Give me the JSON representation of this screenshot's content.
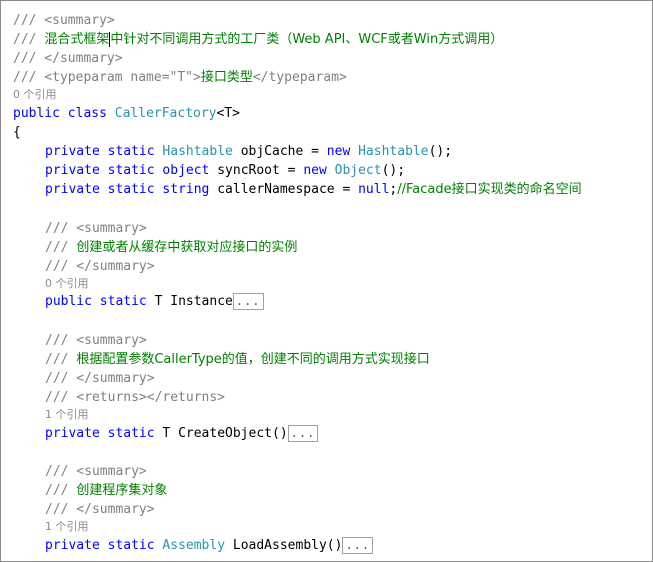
{
  "colors": {
    "keyword": "#0000ff",
    "type": "#2b91af",
    "comment": "#008000",
    "doc_tag": "#808080",
    "ref_hint": "#8a8a8a"
  },
  "class_doc": {
    "summary_open": "/// <summary>",
    "summary_text_a": "混合式框架",
    "summary_text_b": "中针对不同调用方式的工厂类（Web API、WCF或者Win方式调用）",
    "summary_prefix": "/// ",
    "summary_close": "/// </summary>",
    "typeparam_open": "/// <typeparam name=\"T\">",
    "typeparam_text": "接口类型",
    "typeparam_close": "</typeparam>"
  },
  "class_refs": "0 个引用",
  "class_decl": {
    "kw1": "public",
    "kw2": "class",
    "name": "CallerFactory",
    "generic": "<T>"
  },
  "open_brace": "{",
  "fields": [
    {
      "kw1": "private",
      "kw2": "static",
      "type": "Hashtable",
      "name": " objCache = ",
      "kwnew": "new",
      "ctor": "Hashtable",
      "tail": "();"
    },
    {
      "kw1": "private",
      "kw2": "static",
      "type": "object",
      "name": " syncRoot = ",
      "kwnew": "new",
      "ctor": "Object",
      "tail": "();"
    },
    {
      "kw1": "private",
      "kw2": "static",
      "type": "string",
      "name": " callerNamespace = ",
      "kwnew": "null",
      "tail": ";",
      "comment": "//Facade接口实现类的命名空间"
    }
  ],
  "members": [
    {
      "summary_open": "/// <summary>",
      "prefix": "/// ",
      "summary_text": "创建或者从缓存中获取对应接口的实例",
      "summary_close": "/// </summary>",
      "refs": "0 个引用",
      "kw1": "public",
      "kw2": "static",
      "rest": " T Instance",
      "collapsed": "..."
    },
    {
      "summary_open": "/// <summary>",
      "prefix": "/// ",
      "summary_text": "根据配置参数CallerType的值，创建不同的调用方式实现接口",
      "summary_close": "/// </summary>",
      "returns": "/// <returns></returns>",
      "refs": "1 个引用",
      "kw1": "private",
      "kw2": "static",
      "rest": " T CreateObject()",
      "collapsed": "..."
    },
    {
      "summary_open": "/// <summary>",
      "prefix": "/// ",
      "summary_text": "创建程序集对象",
      "summary_close": "/// </summary>",
      "refs": "1 个引用",
      "kw1": "private",
      "kw2": "static",
      "type": "Assembly",
      "rest": " LoadAssembly()",
      "collapsed": "..."
    }
  ]
}
